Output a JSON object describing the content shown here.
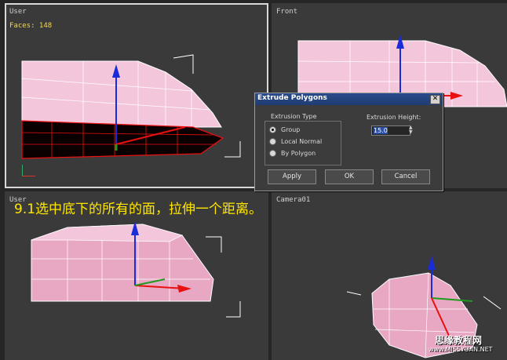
{
  "viewports": {
    "top_left": {
      "label": "User",
      "faces": "Faces: 148"
    },
    "top_right": {
      "label": "Front"
    },
    "bottom_left": {
      "label": "User"
    },
    "bottom_right": {
      "label": "Camera01"
    }
  },
  "dialog": {
    "title": "Extrude Polygons",
    "close_glyph": "✕",
    "extrusion_type": {
      "label": "Extrusion Type",
      "options": [
        "Group",
        "Local Normal",
        "By Polygon"
      ],
      "selected": "Group"
    },
    "extrusion_height": {
      "label": "Extrusion Height:",
      "value": "15.0"
    },
    "buttons": {
      "apply": "Apply",
      "ok": "OK",
      "cancel": "Cancel"
    }
  },
  "caption": "9.1选中底下的所有的面，拉伸一个距离。",
  "watermark": {
    "line1": "思缘教程网",
    "line2": "www.MISSYUAN.NET"
  },
  "colors": {
    "mesh_pink": "#f4c6dc",
    "selection_red": "#e81010",
    "gizmo_blue": "#1a2bd8",
    "caption_yellow": "#ffe600"
  }
}
